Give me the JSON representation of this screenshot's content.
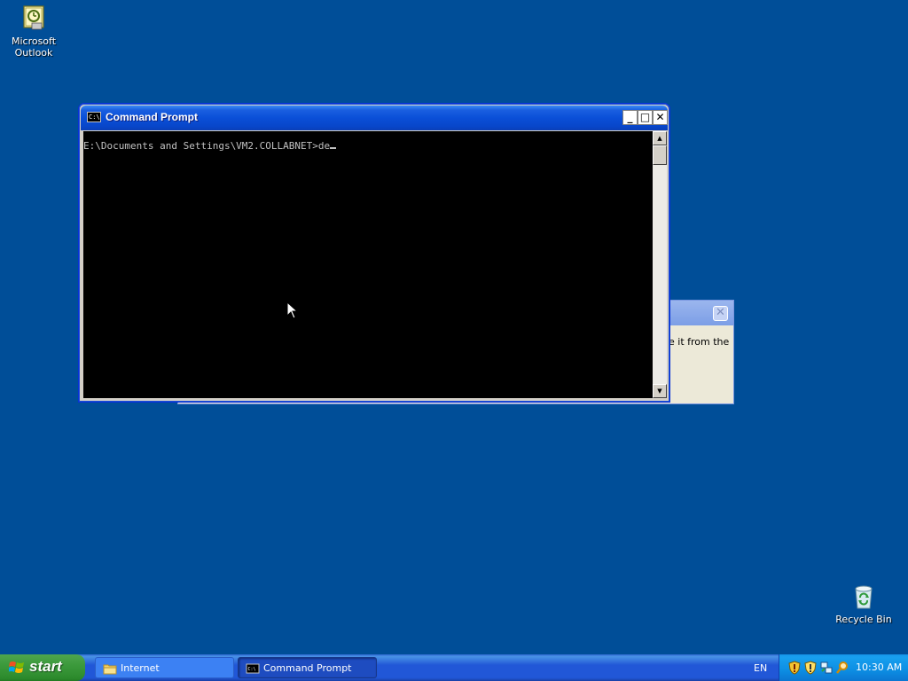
{
  "desktop": {
    "icons": [
      {
        "label": "Microsoft\nOutlook",
        "icon": "outlook-icon"
      },
      {
        "label": "Recycle Bin",
        "icon": "recycle-bin-icon"
      }
    ]
  },
  "background_dialog": {
    "message_fragment": "e it from the",
    "close_label": "✕"
  },
  "cmd_window": {
    "title": "Command Prompt",
    "icon_text": "C:\\",
    "buttons": {
      "minimize": "_",
      "maximize": "□",
      "close": "✕"
    },
    "prompt_line": "E:\\Documents and Settings\\VM2.COLLABNET>de",
    "scroll_up": "▲",
    "scroll_down": "▼"
  },
  "taskbar": {
    "start_label": "start",
    "tasks": [
      {
        "label": "Internet",
        "icon": "folder-icon",
        "active": false
      },
      {
        "label": "Command Prompt",
        "icon": "cmd-icon",
        "active": true
      }
    ],
    "language": "EN",
    "tray_icons": [
      "shield-icon",
      "shield-alert-icon",
      "network-icon",
      "search-icon"
    ],
    "clock": "10:30 AM"
  },
  "colors": {
    "desktop_bg": "#004e98",
    "titlebar_blue": "#0a4fd8",
    "console_bg": "#000000",
    "console_fg": "#c0c0c0",
    "start_green": "#3c9a3c",
    "tray_bg": "#0d8ee3"
  }
}
